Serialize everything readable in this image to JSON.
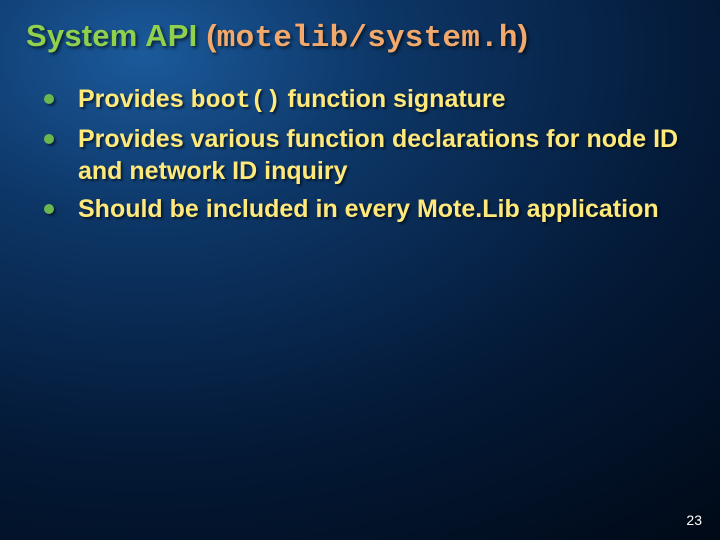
{
  "title": {
    "part1": "System API ",
    "paren_open": "(",
    "code": "motelib/system.h",
    "paren_close": ")"
  },
  "bullets": [
    {
      "pre": "Provides ",
      "code": "boot()",
      "post": " function signature"
    },
    {
      "pre": "Provides various function declarations for node ID and network ID inquiry",
      "code": "",
      "post": ""
    },
    {
      "pre": "Should be included in every Mote.Lib application",
      "code": "",
      "post": ""
    }
  ],
  "page_number": "23"
}
